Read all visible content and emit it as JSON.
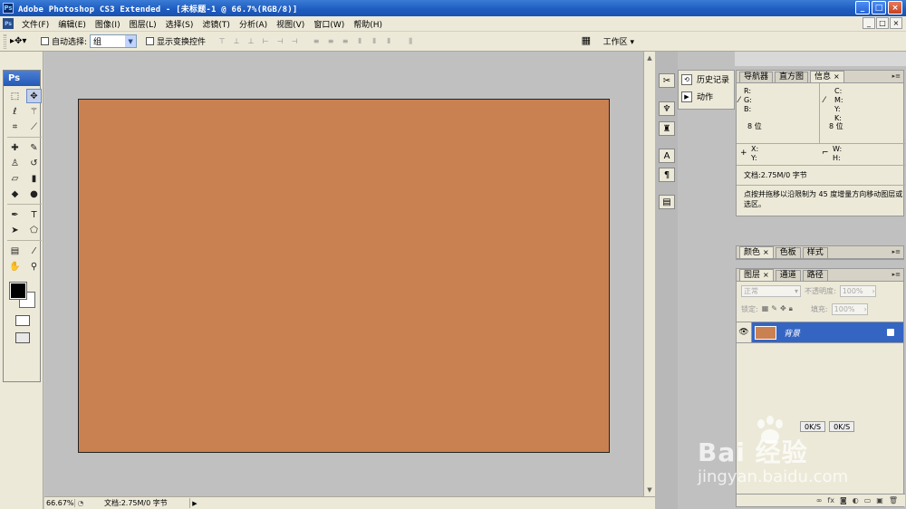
{
  "window": {
    "app_icon": "Ps",
    "title": "Adobe Photoshop CS3 Extended - [未标题-1 @ 66.7%(RGB/8)]",
    "controls": [
      "_",
      "□",
      "×"
    ]
  },
  "menubar": {
    "ps_icon": "Ps",
    "items": [
      "文件(F)",
      "编辑(E)",
      "图像(I)",
      "图层(L)",
      "选择(S)",
      "滤镜(T)",
      "分析(A)",
      "视图(V)",
      "窗口(W)",
      "帮助(H)"
    ],
    "doc_controls": [
      "_",
      "□",
      "×"
    ]
  },
  "options": {
    "auto_select_label": "自动选择:",
    "auto_select_value": "组",
    "show_transform_label": "显示变换控件",
    "workspace_label": "工作区 ▾"
  },
  "toolbox": {
    "title": "Ps",
    "tools": [
      "marquee-icon",
      "move-icon",
      "lasso-icon",
      "magic-wand-icon",
      "crop-icon",
      "slice-icon",
      "healing-icon",
      "brush-icon",
      "stamp-icon",
      "history-brush-icon",
      "eraser-icon",
      "gradient-icon",
      "blur-icon",
      "dodge-icon",
      "pen-icon",
      "type-icon",
      "path-select-icon",
      "shape-icon",
      "notes-icon",
      "eyedropper-icon",
      "hand-icon",
      "zoom-icon"
    ],
    "foreground_color": "#000000",
    "background_color": "#ffffff"
  },
  "canvas": {
    "fill_color": "#c98152"
  },
  "statusbar": {
    "zoom": "66.67%",
    "doc_info": "文档:2.75M/0 字节"
  },
  "dock": {
    "history_label": "历史记录",
    "actions_label": "动作"
  },
  "info_panel": {
    "tabs": [
      "导航器",
      "直方图",
      "信息"
    ],
    "active_tab": "信息",
    "rgb": [
      "R:",
      "G:",
      "B:"
    ],
    "cmyk": [
      "C:",
      "M:",
      "Y:",
      "K:"
    ],
    "bit_left": "8 位",
    "bit_right": "8 位",
    "xy": [
      "X:",
      "Y:"
    ],
    "wh": [
      "W:",
      "H:"
    ],
    "doc_info": "文档:2.75M/0 字节",
    "hint": "点按并拖移以沿限制为 45 度增量方向移动图层或选区。"
  },
  "color_panel": {
    "tabs": [
      "颜色",
      "色板",
      "样式"
    ]
  },
  "layers_panel": {
    "tabs": [
      "图层",
      "通道",
      "路径"
    ],
    "blend_mode": "正常",
    "opacity_label": "不透明度:",
    "opacity_value": "100%",
    "lock_label": "锁定:",
    "fill_label": "填充:",
    "fill_value": "100%",
    "layer_name": "背景",
    "layer_thumb_color": "#c98152",
    "net_up": "0K/S",
    "net_down": "0K/S"
  },
  "watermark": {
    "brand": "Bai 经验",
    "url": "jingyan.baidu.com"
  }
}
